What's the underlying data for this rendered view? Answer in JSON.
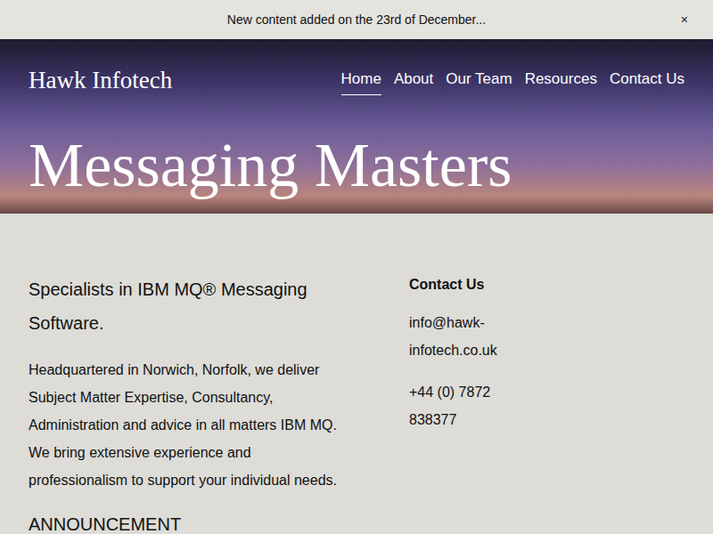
{
  "announcement_bar": {
    "text": "New content added on the 23rd of December...",
    "close": "×"
  },
  "header": {
    "logo": "Hawk Infotech",
    "nav": [
      {
        "label": "Home",
        "selected": true
      },
      {
        "label": "About",
        "selected": false
      },
      {
        "label": "Our Team",
        "selected": false
      },
      {
        "label": "Resources",
        "selected": false
      },
      {
        "label": "Contact Us",
        "selected": false
      }
    ],
    "title": "Messaging Masters"
  },
  "intro": {
    "heading": "Specialists in IBM MQ® Messaging Software.",
    "body": "Headquartered in Norwich, Norfolk, we deliver Subject Matter Expertise, Consultancy, Administration and advice in all matters IBM MQ. We bring extensive experience and professionalism to support your individual needs."
  },
  "contact": {
    "heading": "Contact Us",
    "email": "info@hawk-infotech.co.uk",
    "phone": "+44 (0) 7872 838377"
  },
  "announcement": {
    "heading": "ANNOUNCEMENT"
  }
}
